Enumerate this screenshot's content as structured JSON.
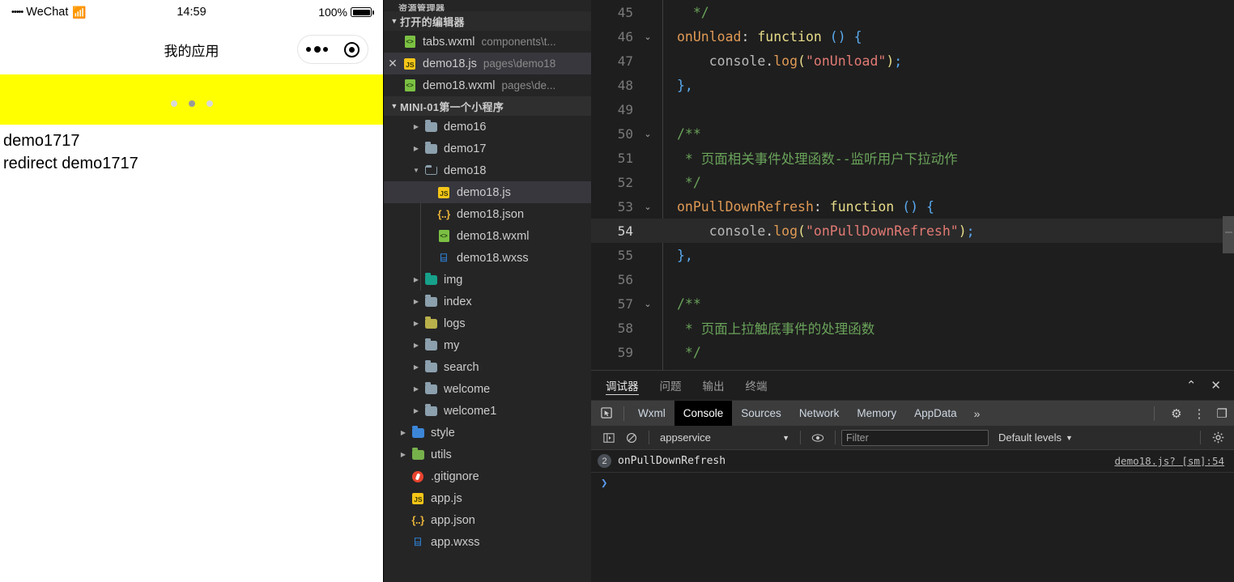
{
  "simulator": {
    "status_bar": {
      "carrier_dots": "•••••",
      "carrier": "WeChat",
      "wifi_icon": "wifi-icon",
      "time": "14:59",
      "battery_percent": "100%",
      "battery_icon": "battery-full-icon"
    },
    "nav": {
      "title": "我的应用",
      "capsule": {
        "more_icon": "more-dots-icon",
        "target_icon": "target-circle-icon"
      }
    },
    "banner": {
      "background_color": "#ffff00",
      "dots": [
        {
          "active": false
        },
        {
          "active": true
        },
        {
          "active": false
        }
      ]
    },
    "body_lines": [
      "demo1717",
      "redirect demo1717"
    ]
  },
  "explorer": {
    "title": "资源管理器",
    "open_editors": {
      "label": "打开的编辑器",
      "caret": "▼",
      "items": [
        {
          "name": "tabs.wxml",
          "path": "components\\t...",
          "icon": "wxml-file-icon",
          "selected": false,
          "has_close": false
        },
        {
          "name": "demo18.js",
          "path": "pages\\demo18",
          "icon": "js-file-icon",
          "selected": true,
          "has_close": true
        },
        {
          "name": "demo18.wxml",
          "path": "pages\\de...",
          "icon": "wxml-file-icon",
          "selected": false,
          "has_close": false
        }
      ]
    },
    "project": {
      "label": "MINI-01第一个小程序",
      "caret": "▼",
      "tree": [
        {
          "label": "demo16",
          "type": "folder",
          "depth": 2,
          "arrow": "▶",
          "selected": false
        },
        {
          "label": "demo17",
          "type": "folder",
          "depth": 2,
          "arrow": "▶",
          "selected": false
        },
        {
          "label": "demo18",
          "type": "folder-open",
          "depth": 2,
          "arrow": "▼",
          "selected": false
        },
        {
          "label": "demo18.js",
          "type": "js",
          "depth": 3,
          "arrow": "",
          "selected": true
        },
        {
          "label": "demo18.json",
          "type": "json",
          "depth": 3,
          "arrow": "",
          "selected": false
        },
        {
          "label": "demo18.wxml",
          "type": "wxml",
          "depth": 3,
          "arrow": "",
          "selected": false
        },
        {
          "label": "demo18.wxss",
          "type": "wxss",
          "depth": 3,
          "arrow": "",
          "selected": false
        },
        {
          "label": "img",
          "type": "folder-img",
          "depth": 2,
          "arrow": "▶",
          "selected": false
        },
        {
          "label": "index",
          "type": "folder",
          "depth": 2,
          "arrow": "▶",
          "selected": false
        },
        {
          "label": "logs",
          "type": "folder-logs",
          "depth": 2,
          "arrow": "▶",
          "selected": false
        },
        {
          "label": "my",
          "type": "folder",
          "depth": 2,
          "arrow": "▶",
          "selected": false
        },
        {
          "label": "search",
          "type": "folder",
          "depth": 2,
          "arrow": "▶",
          "selected": false
        },
        {
          "label": "welcome",
          "type": "folder",
          "depth": 2,
          "arrow": "▶",
          "selected": false
        },
        {
          "label": "welcome1",
          "type": "folder",
          "depth": 2,
          "arrow": "▶",
          "selected": false
        },
        {
          "label": "style",
          "type": "folder-style",
          "depth": 1,
          "arrow": "▶",
          "selected": false
        },
        {
          "label": "utils",
          "type": "folder-utils",
          "depth": 1,
          "arrow": "▶",
          "selected": false
        },
        {
          "label": ".gitignore",
          "type": "git",
          "depth": 1,
          "arrow": "",
          "selected": false
        },
        {
          "label": "app.js",
          "type": "js",
          "depth": 1,
          "arrow": "",
          "selected": false
        },
        {
          "label": "app.json",
          "type": "json",
          "depth": 1,
          "arrow": "",
          "selected": false
        },
        {
          "label": "app.wxss",
          "type": "wxss",
          "depth": 1,
          "arrow": "",
          "selected": false
        }
      ]
    }
  },
  "editor": {
    "active_line": 54,
    "lines": [
      {
        "n": 45,
        "fold": "",
        "active": false,
        "tokens": [
          {
            "t": "  ",
            "c": "tk-wh"
          },
          {
            "t": "*/",
            "c": "tk-com"
          }
        ]
      },
      {
        "n": 46,
        "fold": "⌄",
        "active": false,
        "tokens": [
          {
            "t": "onUnload",
            "c": "tk-key"
          },
          {
            "t": ": ",
            "c": "tk-wh"
          },
          {
            "t": "function",
            "c": "tk-fn"
          },
          {
            "t": " ",
            "c": "tk-wh"
          },
          {
            "t": "()",
            "c": "tk-pun"
          },
          {
            "t": " ",
            "c": "tk-wh"
          },
          {
            "t": "{",
            "c": "tk-pun"
          }
        ]
      },
      {
        "n": 47,
        "fold": "",
        "active": false,
        "tokens": [
          {
            "t": "    ",
            "c": "tk-wh"
          },
          {
            "t": "console",
            "c": "tk-obj"
          },
          {
            "t": ".",
            "c": "tk-wh"
          },
          {
            "t": "log",
            "c": "tk-meth"
          },
          {
            "t": "(",
            "c": "tk-yl"
          },
          {
            "t": "\"onUnload\"",
            "c": "tk-str"
          },
          {
            "t": ")",
            "c": "tk-yl"
          },
          {
            "t": ";",
            "c": "tk-pun"
          }
        ]
      },
      {
        "n": 48,
        "fold": "",
        "active": false,
        "tokens": [
          {
            "t": "},",
            "c": "tk-pun"
          }
        ]
      },
      {
        "n": 49,
        "fold": "",
        "active": false,
        "tokens": []
      },
      {
        "n": 50,
        "fold": "⌄",
        "active": false,
        "tokens": [
          {
            "t": "/**",
            "c": "tk-com"
          }
        ]
      },
      {
        "n": 51,
        "fold": "",
        "active": false,
        "tokens": [
          {
            "t": " * 页面相关事件处理函数--监听用户下拉动作",
            "c": "tk-com"
          }
        ]
      },
      {
        "n": 52,
        "fold": "",
        "active": false,
        "tokens": [
          {
            "t": " */",
            "c": "tk-com"
          }
        ]
      },
      {
        "n": 53,
        "fold": "⌄",
        "active": false,
        "tokens": [
          {
            "t": "onPullDownRefresh",
            "c": "tk-key"
          },
          {
            "t": ": ",
            "c": "tk-wh"
          },
          {
            "t": "function",
            "c": "tk-fn"
          },
          {
            "t": " ",
            "c": "tk-wh"
          },
          {
            "t": "()",
            "c": "tk-pun"
          },
          {
            "t": " ",
            "c": "tk-wh"
          },
          {
            "t": "{",
            "c": "tk-pun"
          }
        ]
      },
      {
        "n": 54,
        "fold": "",
        "active": true,
        "tokens": [
          {
            "t": "    ",
            "c": "tk-wh"
          },
          {
            "t": "console",
            "c": "tk-obj"
          },
          {
            "t": ".",
            "c": "tk-wh"
          },
          {
            "t": "log",
            "c": "tk-meth"
          },
          {
            "t": "(",
            "c": "tk-yl"
          },
          {
            "t": "\"onPullDownRefresh\"",
            "c": "tk-str"
          },
          {
            "t": ")",
            "c": "tk-yl"
          },
          {
            "t": ";",
            "c": "tk-pun"
          }
        ]
      },
      {
        "n": 55,
        "fold": "",
        "active": false,
        "tokens": [
          {
            "t": "},",
            "c": "tk-pun"
          }
        ]
      },
      {
        "n": 56,
        "fold": "",
        "active": false,
        "tokens": []
      },
      {
        "n": 57,
        "fold": "⌄",
        "active": false,
        "tokens": [
          {
            "t": "/**",
            "c": "tk-com"
          }
        ]
      },
      {
        "n": 58,
        "fold": "",
        "active": false,
        "tokens": [
          {
            "t": " * 页面上拉触底事件的处理函数",
            "c": "tk-com"
          }
        ]
      },
      {
        "n": 59,
        "fold": "",
        "active": false,
        "tokens": [
          {
            "t": " */",
            "c": "tk-com"
          }
        ]
      }
    ]
  },
  "panel": {
    "tabs": [
      {
        "label": "调试器",
        "active": true
      },
      {
        "label": "问题",
        "active": false
      },
      {
        "label": "输出",
        "active": false
      },
      {
        "label": "终端",
        "active": false
      }
    ],
    "actions": [
      {
        "icon": "chevron-up-icon",
        "glyph": "⌃"
      },
      {
        "icon": "close-icon",
        "glyph": "✕"
      }
    ],
    "devtools": {
      "inspect_icon": "inspect-element-icon",
      "tabs": [
        {
          "label": "Wxml",
          "active": false
        },
        {
          "label": "Console",
          "active": true
        },
        {
          "label": "Sources",
          "active": false
        },
        {
          "label": "Network",
          "active": false
        },
        {
          "label": "Memory",
          "active": false
        },
        {
          "label": "AppData",
          "active": false
        }
      ],
      "overflow": "»",
      "right_icons": [
        {
          "icon": "gear-icon",
          "glyph": "⚙"
        },
        {
          "icon": "kebab-menu-icon",
          "glyph": "⋮"
        },
        {
          "icon": "dock-panel-icon",
          "glyph": "❐"
        }
      ]
    },
    "console": {
      "sidebar_toggle_icon": "console-sidebar-icon",
      "clear_icon": "clear-console-icon",
      "context": "appservice",
      "context_caret": "▼",
      "eye_icon": "live-expression-icon",
      "filter_placeholder": "Filter",
      "filter_value": "",
      "levels": "Default levels",
      "levels_caret": "▼",
      "settings_icon": "gear-icon",
      "messages": [
        {
          "count": "2",
          "text": "onPullDownRefresh",
          "source": "demo18.js? [sm]:54"
        }
      ],
      "prompt": "❯"
    }
  }
}
